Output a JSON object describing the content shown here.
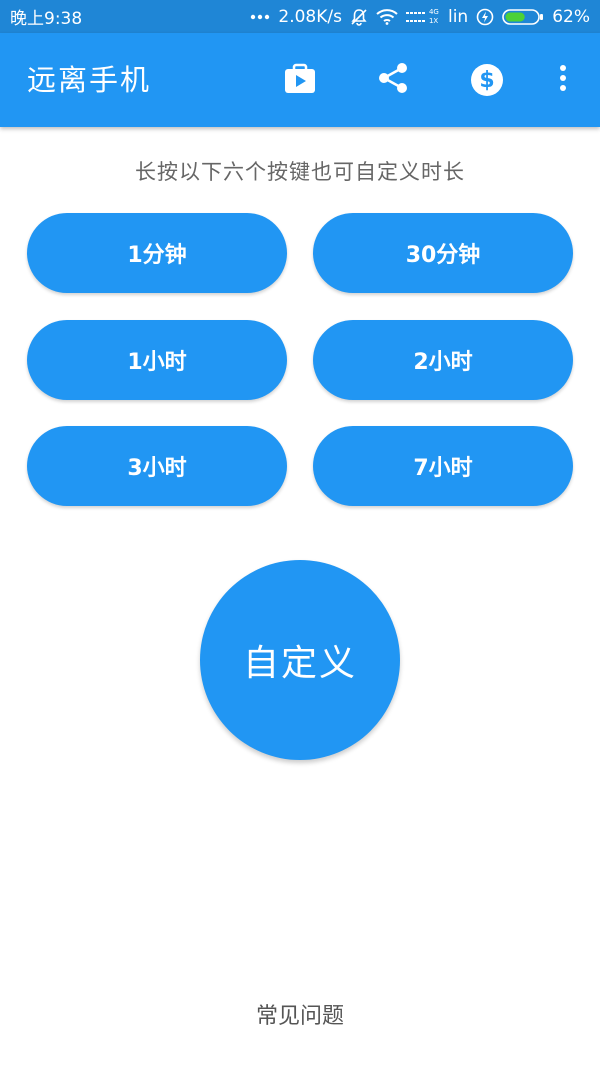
{
  "status_bar": {
    "time": "晚上9:38",
    "network_speed": "2.08K/s",
    "carrier": "lin",
    "battery_percent": "62%",
    "battery_level": 0.62,
    "icons": [
      "dots-icon",
      "mute-bell-icon",
      "wifi-icon",
      "signal-icon",
      "charging-icon",
      "battery-icon"
    ],
    "network_type_top": "4G",
    "network_type_bottom": "1X"
  },
  "toolbar": {
    "title": "远离手机",
    "actions": [
      "store-icon",
      "share-icon",
      "donate-icon",
      "more-vert-icon"
    ],
    "donate_symbol": "$"
  },
  "hint": "长按以下六个按键也可自定义时长",
  "presets": [
    {
      "label": "1分钟"
    },
    {
      "label": "30分钟"
    },
    {
      "label": "1小时"
    },
    {
      "label": "2小时"
    },
    {
      "label": "3小时"
    },
    {
      "label": "7小时"
    }
  ],
  "custom_button": "自定义",
  "faq_link": "常见问题",
  "colors": {
    "primary": "#2196f3",
    "status_bar": "#1f86d6",
    "hint_text": "#666666",
    "battery_fill": "#4cd137"
  }
}
